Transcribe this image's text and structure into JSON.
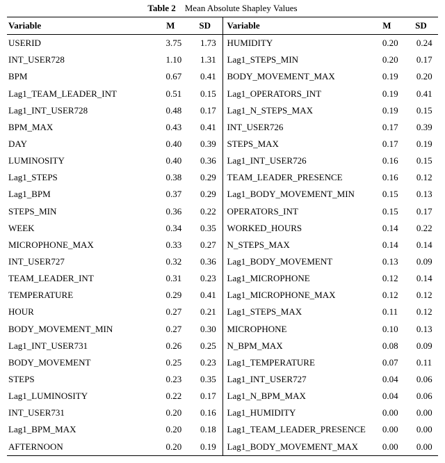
{
  "caption": {
    "label": "Table 2",
    "title": "Mean Absolute Shapley Values"
  },
  "headers": {
    "variable": "Variable",
    "m": "M",
    "sd": "SD"
  },
  "chart_data": {
    "type": "table",
    "title": "Mean Absolute Shapley Values",
    "columns": [
      "Variable",
      "M",
      "SD"
    ],
    "left": [
      {
        "name": "USERID",
        "m": "3.75",
        "sd": "1.73"
      },
      {
        "name": "INT_USER728",
        "m": "1.10",
        "sd": "1.31"
      },
      {
        "name": "BPM",
        "m": "0.67",
        "sd": "0.41"
      },
      {
        "name": "Lag1_TEAM_LEADER_INT",
        "m": "0.51",
        "sd": "0.15"
      },
      {
        "name": "Lag1_INT_USER728",
        "m": "0.48",
        "sd": "0.17"
      },
      {
        "name": "BPM_MAX",
        "m": "0.43",
        "sd": "0.41"
      },
      {
        "name": "DAY",
        "m": "0.40",
        "sd": "0.39"
      },
      {
        "name": "LUMINOSITY",
        "m": "0.40",
        "sd": "0.36"
      },
      {
        "name": "Lag1_STEPS",
        "m": "0.38",
        "sd": "0.29"
      },
      {
        "name": "Lag1_BPM",
        "m": "0.37",
        "sd": "0.29"
      },
      {
        "name": "STEPS_MIN",
        "m": "0.36",
        "sd": "0.22"
      },
      {
        "name": "WEEK",
        "m": "0.34",
        "sd": "0.35"
      },
      {
        "name": "MICROPHONE_MAX",
        "m": "0.33",
        "sd": "0.27"
      },
      {
        "name": "INT_USER727",
        "m": "0.32",
        "sd": "0.36"
      },
      {
        "name": "TEAM_LEADER_INT",
        "m": "0.31",
        "sd": "0.23"
      },
      {
        "name": "TEMPERATURE",
        "m": "0.29",
        "sd": "0.41"
      },
      {
        "name": "HOUR",
        "m": "0.27",
        "sd": "0.21"
      },
      {
        "name": "BODY_MOVEMENT_MIN",
        "m": "0.27",
        "sd": "0.30"
      },
      {
        "name": "Lag1_INT_USER731",
        "m": "0.26",
        "sd": "0.25"
      },
      {
        "name": "BODY_MOVEMENT",
        "m": "0.25",
        "sd": "0.23"
      },
      {
        "name": "STEPS",
        "m": "0.23",
        "sd": "0.35"
      },
      {
        "name": "Lag1_LUMINOSITY",
        "m": "0.22",
        "sd": "0.17"
      },
      {
        "name": "INT_USER731",
        "m": "0.20",
        "sd": "0.16"
      },
      {
        "name": "Lag1_BPM_MAX",
        "m": "0.20",
        "sd": "0.18"
      },
      {
        "name": "AFTERNOON",
        "m": "0.20",
        "sd": "0.19"
      }
    ],
    "right": [
      {
        "name": "HUMIDITY",
        "m": "0.20",
        "sd": "0.24"
      },
      {
        "name": "Lag1_STEPS_MIN",
        "m": "0.20",
        "sd": "0.17"
      },
      {
        "name": "BODY_MOVEMENT_MAX",
        "m": "0.19",
        "sd": "0.20"
      },
      {
        "name": "Lag1_OPERATORS_INT",
        "m": "0.19",
        "sd": "0.41"
      },
      {
        "name": "Lag1_N_STEPS_MAX",
        "m": "0.19",
        "sd": "0.15"
      },
      {
        "name": "INT_USER726",
        "m": "0.17",
        "sd": "0.39"
      },
      {
        "name": "STEPS_MAX",
        "m": "0.17",
        "sd": "0.19"
      },
      {
        "name": "Lag1_INT_USER726",
        "m": "0.16",
        "sd": "0.15"
      },
      {
        "name": "TEAM_LEADER_PRESENCE",
        "m": "0.16",
        "sd": "0.12"
      },
      {
        "name": "Lag1_BODY_MOVEMENT_MIN",
        "m": "0.15",
        "sd": "0.13"
      },
      {
        "name": "OPERATORS_INT",
        "m": "0.15",
        "sd": "0.17"
      },
      {
        "name": "WORKED_HOURS",
        "m": "0.14",
        "sd": "0.22"
      },
      {
        "name": "N_STEPS_MAX",
        "m": "0.14",
        "sd": "0.14"
      },
      {
        "name": "Lag1_BODY_MOVEMENT",
        "m": "0.13",
        "sd": "0.09"
      },
      {
        "name": "Lag1_MICROPHONE",
        "m": "0.12",
        "sd": "0.14"
      },
      {
        "name": "Lag1_MICROPHONE_MAX",
        "m": "0.12",
        "sd": "0.12"
      },
      {
        "name": "Lag1_STEPS_MAX",
        "m": "0.11",
        "sd": "0.12"
      },
      {
        "name": "MICROPHONE",
        "m": "0.10",
        "sd": "0.13"
      },
      {
        "name": "N_BPM_MAX",
        "m": "0.08",
        "sd": "0.09"
      },
      {
        "name": "Lag1_TEMPERATURE",
        "m": "0.07",
        "sd": "0.11"
      },
      {
        "name": "Lag1_INT_USER727",
        "m": "0.04",
        "sd": "0.06"
      },
      {
        "name": "Lag1_N_BPM_MAX",
        "m": "0.04",
        "sd": "0.06"
      },
      {
        "name": "Lag1_HUMIDITY",
        "m": "0.00",
        "sd": "0.00"
      },
      {
        "name": "Lag1_TEAM_LEADER_PRESENCE",
        "m": "0.00",
        "sd": "0.00"
      },
      {
        "name": "Lag1_BODY_MOVEMENT_MAX",
        "m": "0.00",
        "sd": "0.00"
      }
    ]
  }
}
